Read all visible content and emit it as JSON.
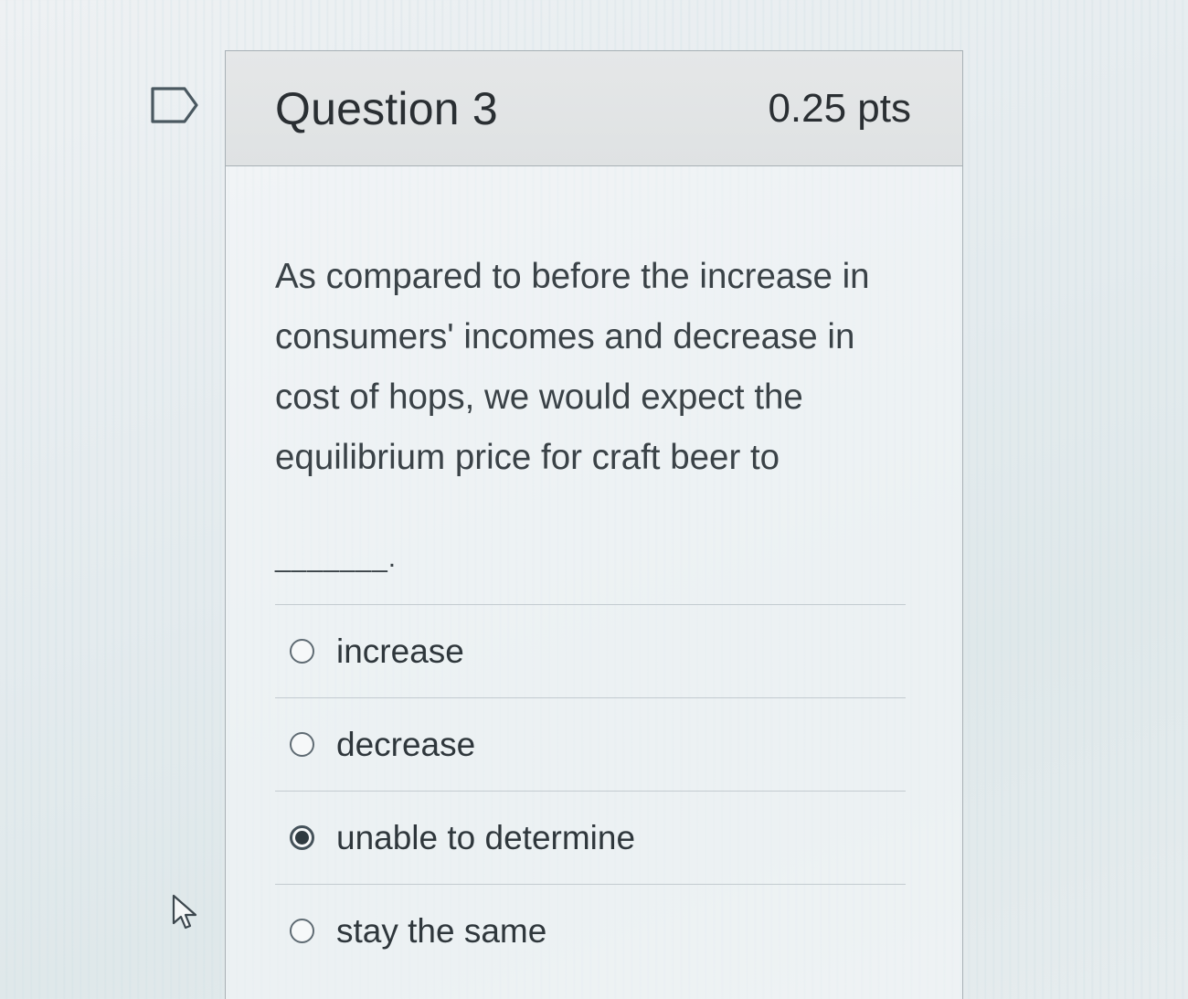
{
  "question": {
    "title": "Question 3",
    "points": "0.25 pts",
    "text": "As compared to before the increase in consumers' incomes and decrease in cost of hops, we would expect the equilibrium price for craft beer to",
    "blank": "_______."
  },
  "answers": [
    {
      "label": "increase",
      "selected": false
    },
    {
      "label": "decrease",
      "selected": false
    },
    {
      "label": "unable to determine",
      "selected": true
    },
    {
      "label": "stay the same",
      "selected": false
    }
  ],
  "icons": {
    "flag": "flag-question-icon",
    "cursor": "mouse-pointer-icon"
  }
}
